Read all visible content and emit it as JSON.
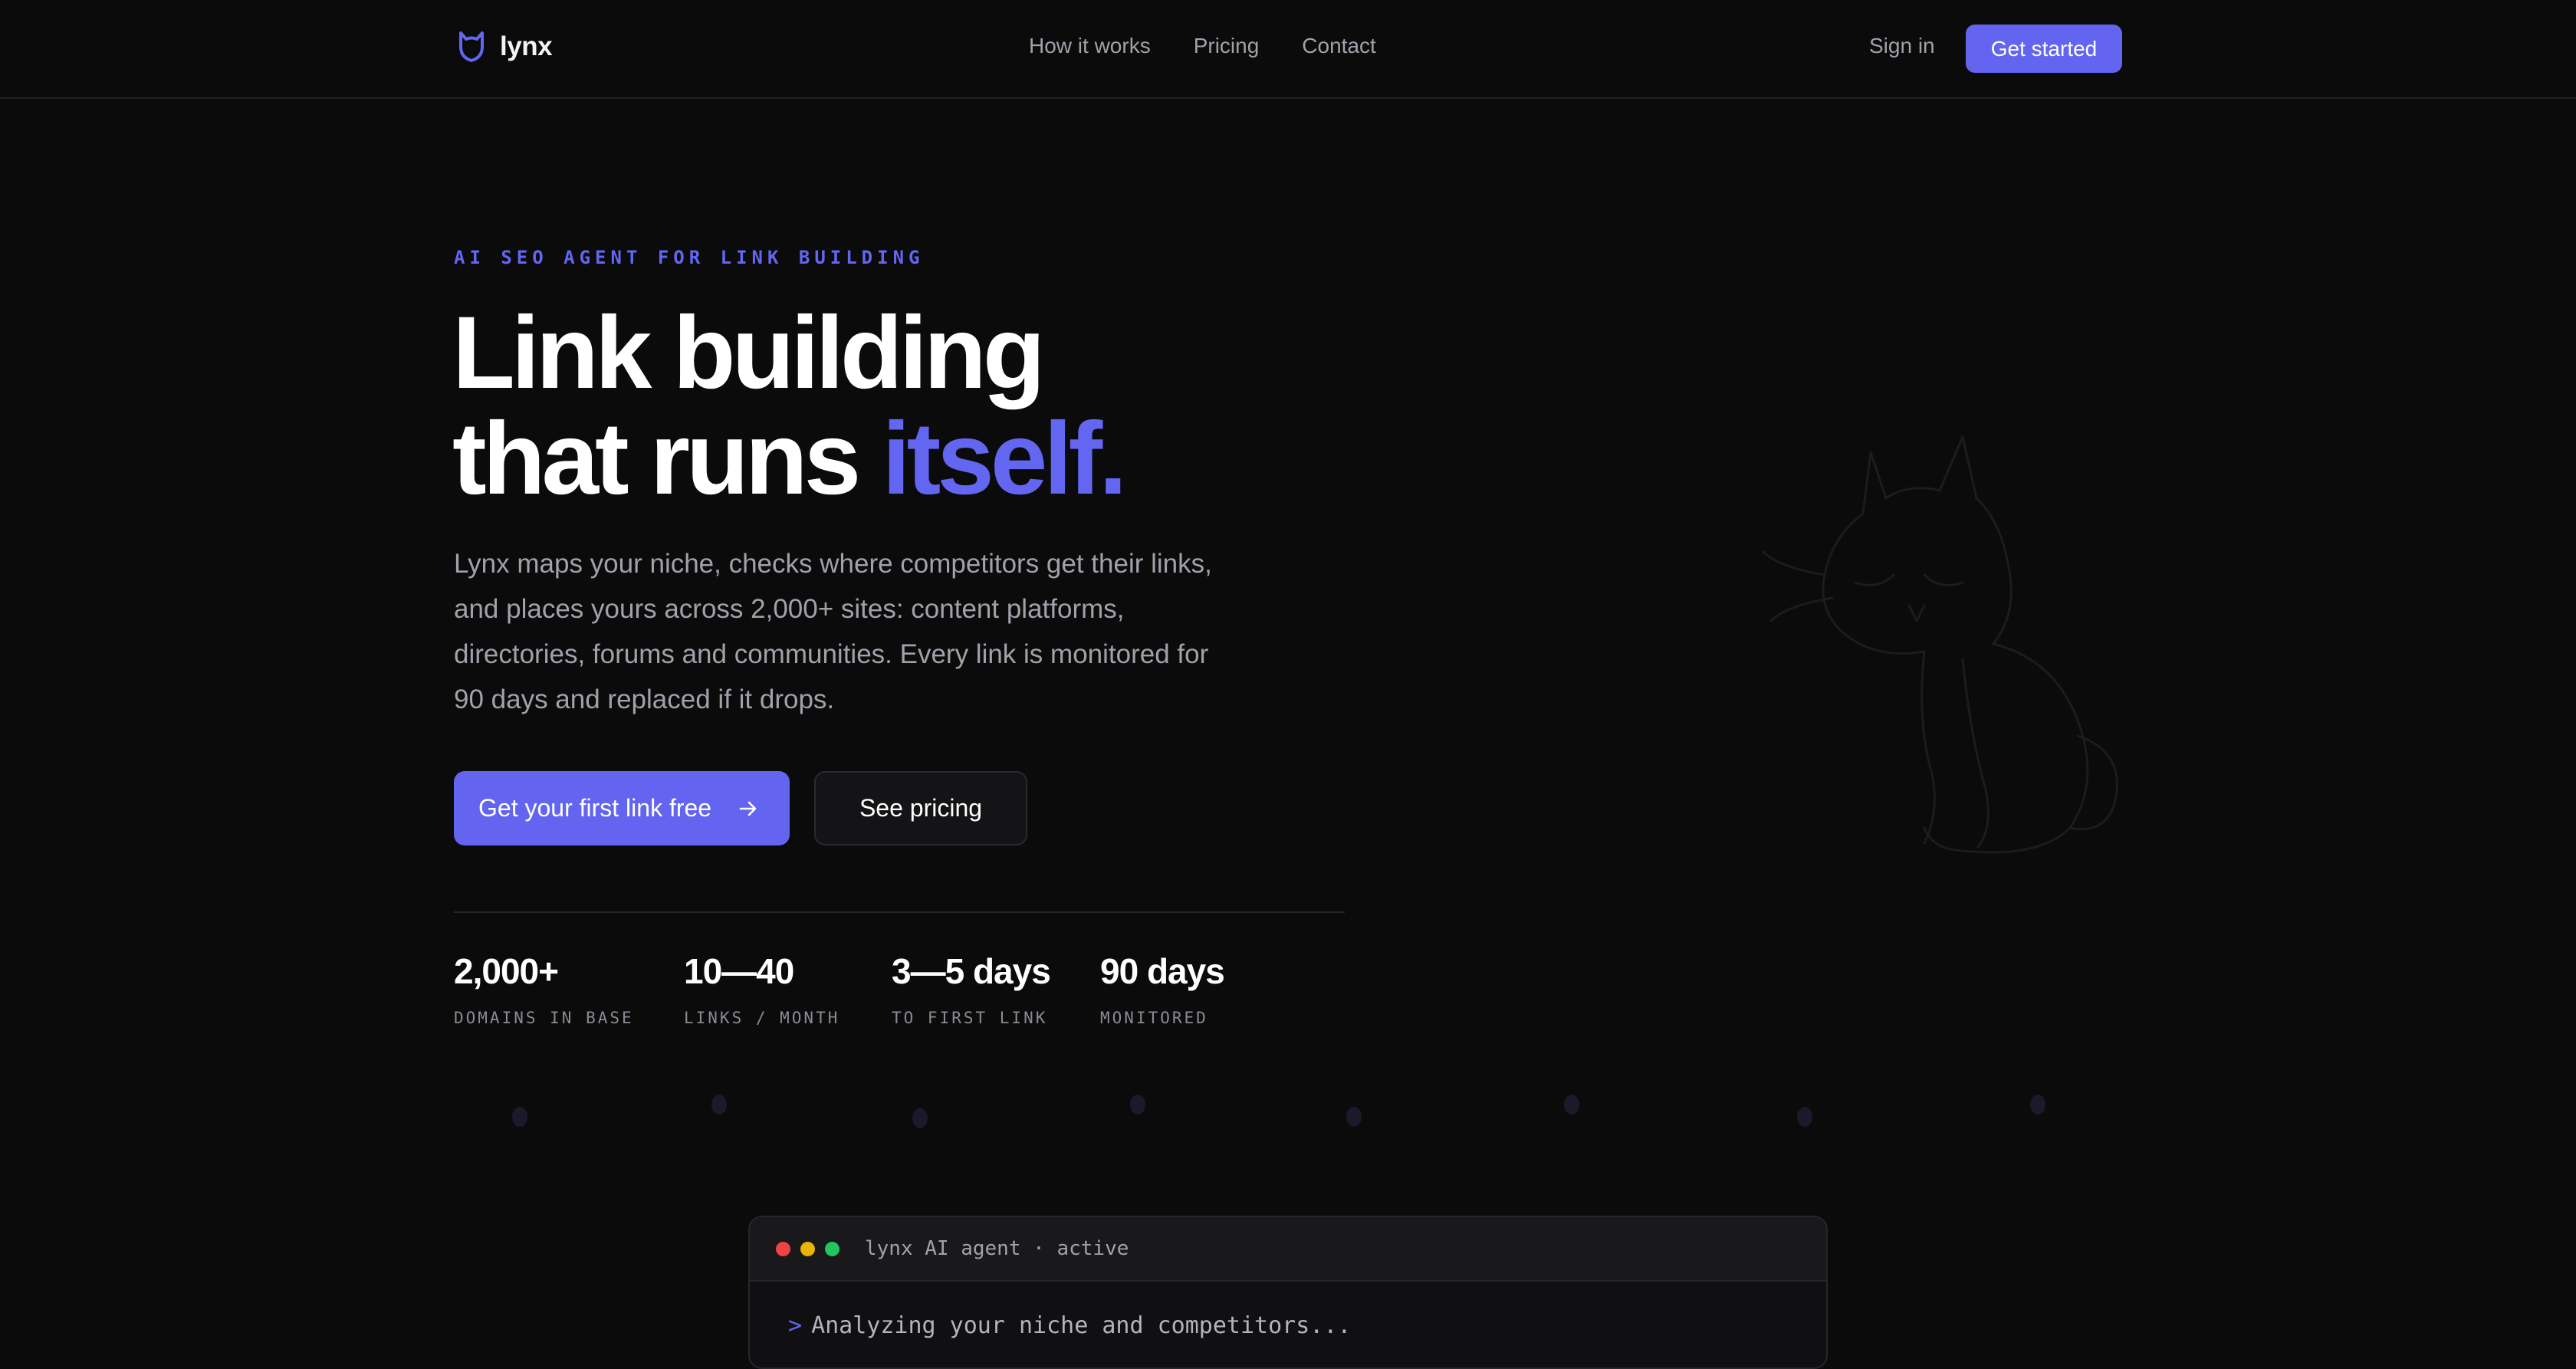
{
  "brand": {
    "name": "lynx",
    "accent_color": "#6366f1",
    "logo_icon": "shield-cat-icon"
  },
  "nav": {
    "links": [
      "How it works",
      "Pricing",
      "Contact"
    ],
    "signin_label": "Sign in",
    "cta_label": "Get started"
  },
  "hero": {
    "eyebrow": "AI SEO AGENT FOR LINK BUILDING",
    "headline_line1": "Link building",
    "headline_line2_prefix": "that runs ",
    "headline_line2_accent": "itself.",
    "lede": "Lynx maps your niche, checks where competitors get their links, and places yours across 2,000+ sites: content platforms, directories, forums and communities. Every link is monitored for 90 days and replaced if it drops.",
    "primary_cta": "Get your first link free",
    "primary_cta_icon": "arrow-right-icon",
    "secondary_cta": "See pricing"
  },
  "stats": [
    {
      "value": "2,000+",
      "label": "DOMAINS IN BASE"
    },
    {
      "value": "10—40",
      "label": "LINKS / MONTH"
    },
    {
      "value": "3—5 days",
      "label": "TO FIRST LINK"
    },
    {
      "value": "90 days",
      "label": "MONITORED"
    }
  ],
  "terminal": {
    "title": "lynx AI agent · active",
    "dot_colors": [
      "#ef4444",
      "#eab308",
      "#22c55e"
    ],
    "prompt": ">",
    "line": "Analyzing your niche and competitors..."
  }
}
